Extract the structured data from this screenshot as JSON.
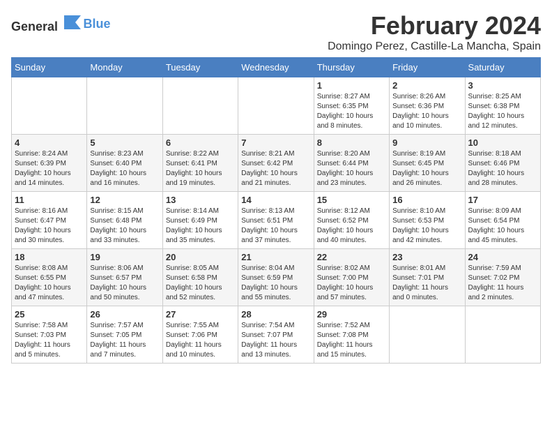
{
  "header": {
    "logo_general": "General",
    "logo_blue": "Blue",
    "title": "February 2024",
    "subtitle": "Domingo Perez, Castille-La Mancha, Spain"
  },
  "weekdays": [
    "Sunday",
    "Monday",
    "Tuesday",
    "Wednesday",
    "Thursday",
    "Friday",
    "Saturday"
  ],
  "weeks": [
    [
      {
        "day": "",
        "info": ""
      },
      {
        "day": "",
        "info": ""
      },
      {
        "day": "",
        "info": ""
      },
      {
        "day": "",
        "info": ""
      },
      {
        "day": "1",
        "info": "Sunrise: 8:27 AM\nSunset: 6:35 PM\nDaylight: 10 hours\nand 8 minutes."
      },
      {
        "day": "2",
        "info": "Sunrise: 8:26 AM\nSunset: 6:36 PM\nDaylight: 10 hours\nand 10 minutes."
      },
      {
        "day": "3",
        "info": "Sunrise: 8:25 AM\nSunset: 6:38 PM\nDaylight: 10 hours\nand 12 minutes."
      }
    ],
    [
      {
        "day": "4",
        "info": "Sunrise: 8:24 AM\nSunset: 6:39 PM\nDaylight: 10 hours\nand 14 minutes."
      },
      {
        "day": "5",
        "info": "Sunrise: 8:23 AM\nSunset: 6:40 PM\nDaylight: 10 hours\nand 16 minutes."
      },
      {
        "day": "6",
        "info": "Sunrise: 8:22 AM\nSunset: 6:41 PM\nDaylight: 10 hours\nand 19 minutes."
      },
      {
        "day": "7",
        "info": "Sunrise: 8:21 AM\nSunset: 6:42 PM\nDaylight: 10 hours\nand 21 minutes."
      },
      {
        "day": "8",
        "info": "Sunrise: 8:20 AM\nSunset: 6:44 PM\nDaylight: 10 hours\nand 23 minutes."
      },
      {
        "day": "9",
        "info": "Sunrise: 8:19 AM\nSunset: 6:45 PM\nDaylight: 10 hours\nand 26 minutes."
      },
      {
        "day": "10",
        "info": "Sunrise: 8:18 AM\nSunset: 6:46 PM\nDaylight: 10 hours\nand 28 minutes."
      }
    ],
    [
      {
        "day": "11",
        "info": "Sunrise: 8:16 AM\nSunset: 6:47 PM\nDaylight: 10 hours\nand 30 minutes."
      },
      {
        "day": "12",
        "info": "Sunrise: 8:15 AM\nSunset: 6:48 PM\nDaylight: 10 hours\nand 33 minutes."
      },
      {
        "day": "13",
        "info": "Sunrise: 8:14 AM\nSunset: 6:49 PM\nDaylight: 10 hours\nand 35 minutes."
      },
      {
        "day": "14",
        "info": "Sunrise: 8:13 AM\nSunset: 6:51 PM\nDaylight: 10 hours\nand 37 minutes."
      },
      {
        "day": "15",
        "info": "Sunrise: 8:12 AM\nSunset: 6:52 PM\nDaylight: 10 hours\nand 40 minutes."
      },
      {
        "day": "16",
        "info": "Sunrise: 8:10 AM\nSunset: 6:53 PM\nDaylight: 10 hours\nand 42 minutes."
      },
      {
        "day": "17",
        "info": "Sunrise: 8:09 AM\nSunset: 6:54 PM\nDaylight: 10 hours\nand 45 minutes."
      }
    ],
    [
      {
        "day": "18",
        "info": "Sunrise: 8:08 AM\nSunset: 6:55 PM\nDaylight: 10 hours\nand 47 minutes."
      },
      {
        "day": "19",
        "info": "Sunrise: 8:06 AM\nSunset: 6:57 PM\nDaylight: 10 hours\nand 50 minutes."
      },
      {
        "day": "20",
        "info": "Sunrise: 8:05 AM\nSunset: 6:58 PM\nDaylight: 10 hours\nand 52 minutes."
      },
      {
        "day": "21",
        "info": "Sunrise: 8:04 AM\nSunset: 6:59 PM\nDaylight: 10 hours\nand 55 minutes."
      },
      {
        "day": "22",
        "info": "Sunrise: 8:02 AM\nSunset: 7:00 PM\nDaylight: 10 hours\nand 57 minutes."
      },
      {
        "day": "23",
        "info": "Sunrise: 8:01 AM\nSunset: 7:01 PM\nDaylight: 11 hours\nand 0 minutes."
      },
      {
        "day": "24",
        "info": "Sunrise: 7:59 AM\nSunset: 7:02 PM\nDaylight: 11 hours\nand 2 minutes."
      }
    ],
    [
      {
        "day": "25",
        "info": "Sunrise: 7:58 AM\nSunset: 7:03 PM\nDaylight: 11 hours\nand 5 minutes."
      },
      {
        "day": "26",
        "info": "Sunrise: 7:57 AM\nSunset: 7:05 PM\nDaylight: 11 hours\nand 7 minutes."
      },
      {
        "day": "27",
        "info": "Sunrise: 7:55 AM\nSunset: 7:06 PM\nDaylight: 11 hours\nand 10 minutes."
      },
      {
        "day": "28",
        "info": "Sunrise: 7:54 AM\nSunset: 7:07 PM\nDaylight: 11 hours\nand 13 minutes."
      },
      {
        "day": "29",
        "info": "Sunrise: 7:52 AM\nSunset: 7:08 PM\nDaylight: 11 hours\nand 15 minutes."
      },
      {
        "day": "",
        "info": ""
      },
      {
        "day": "",
        "info": ""
      }
    ]
  ]
}
